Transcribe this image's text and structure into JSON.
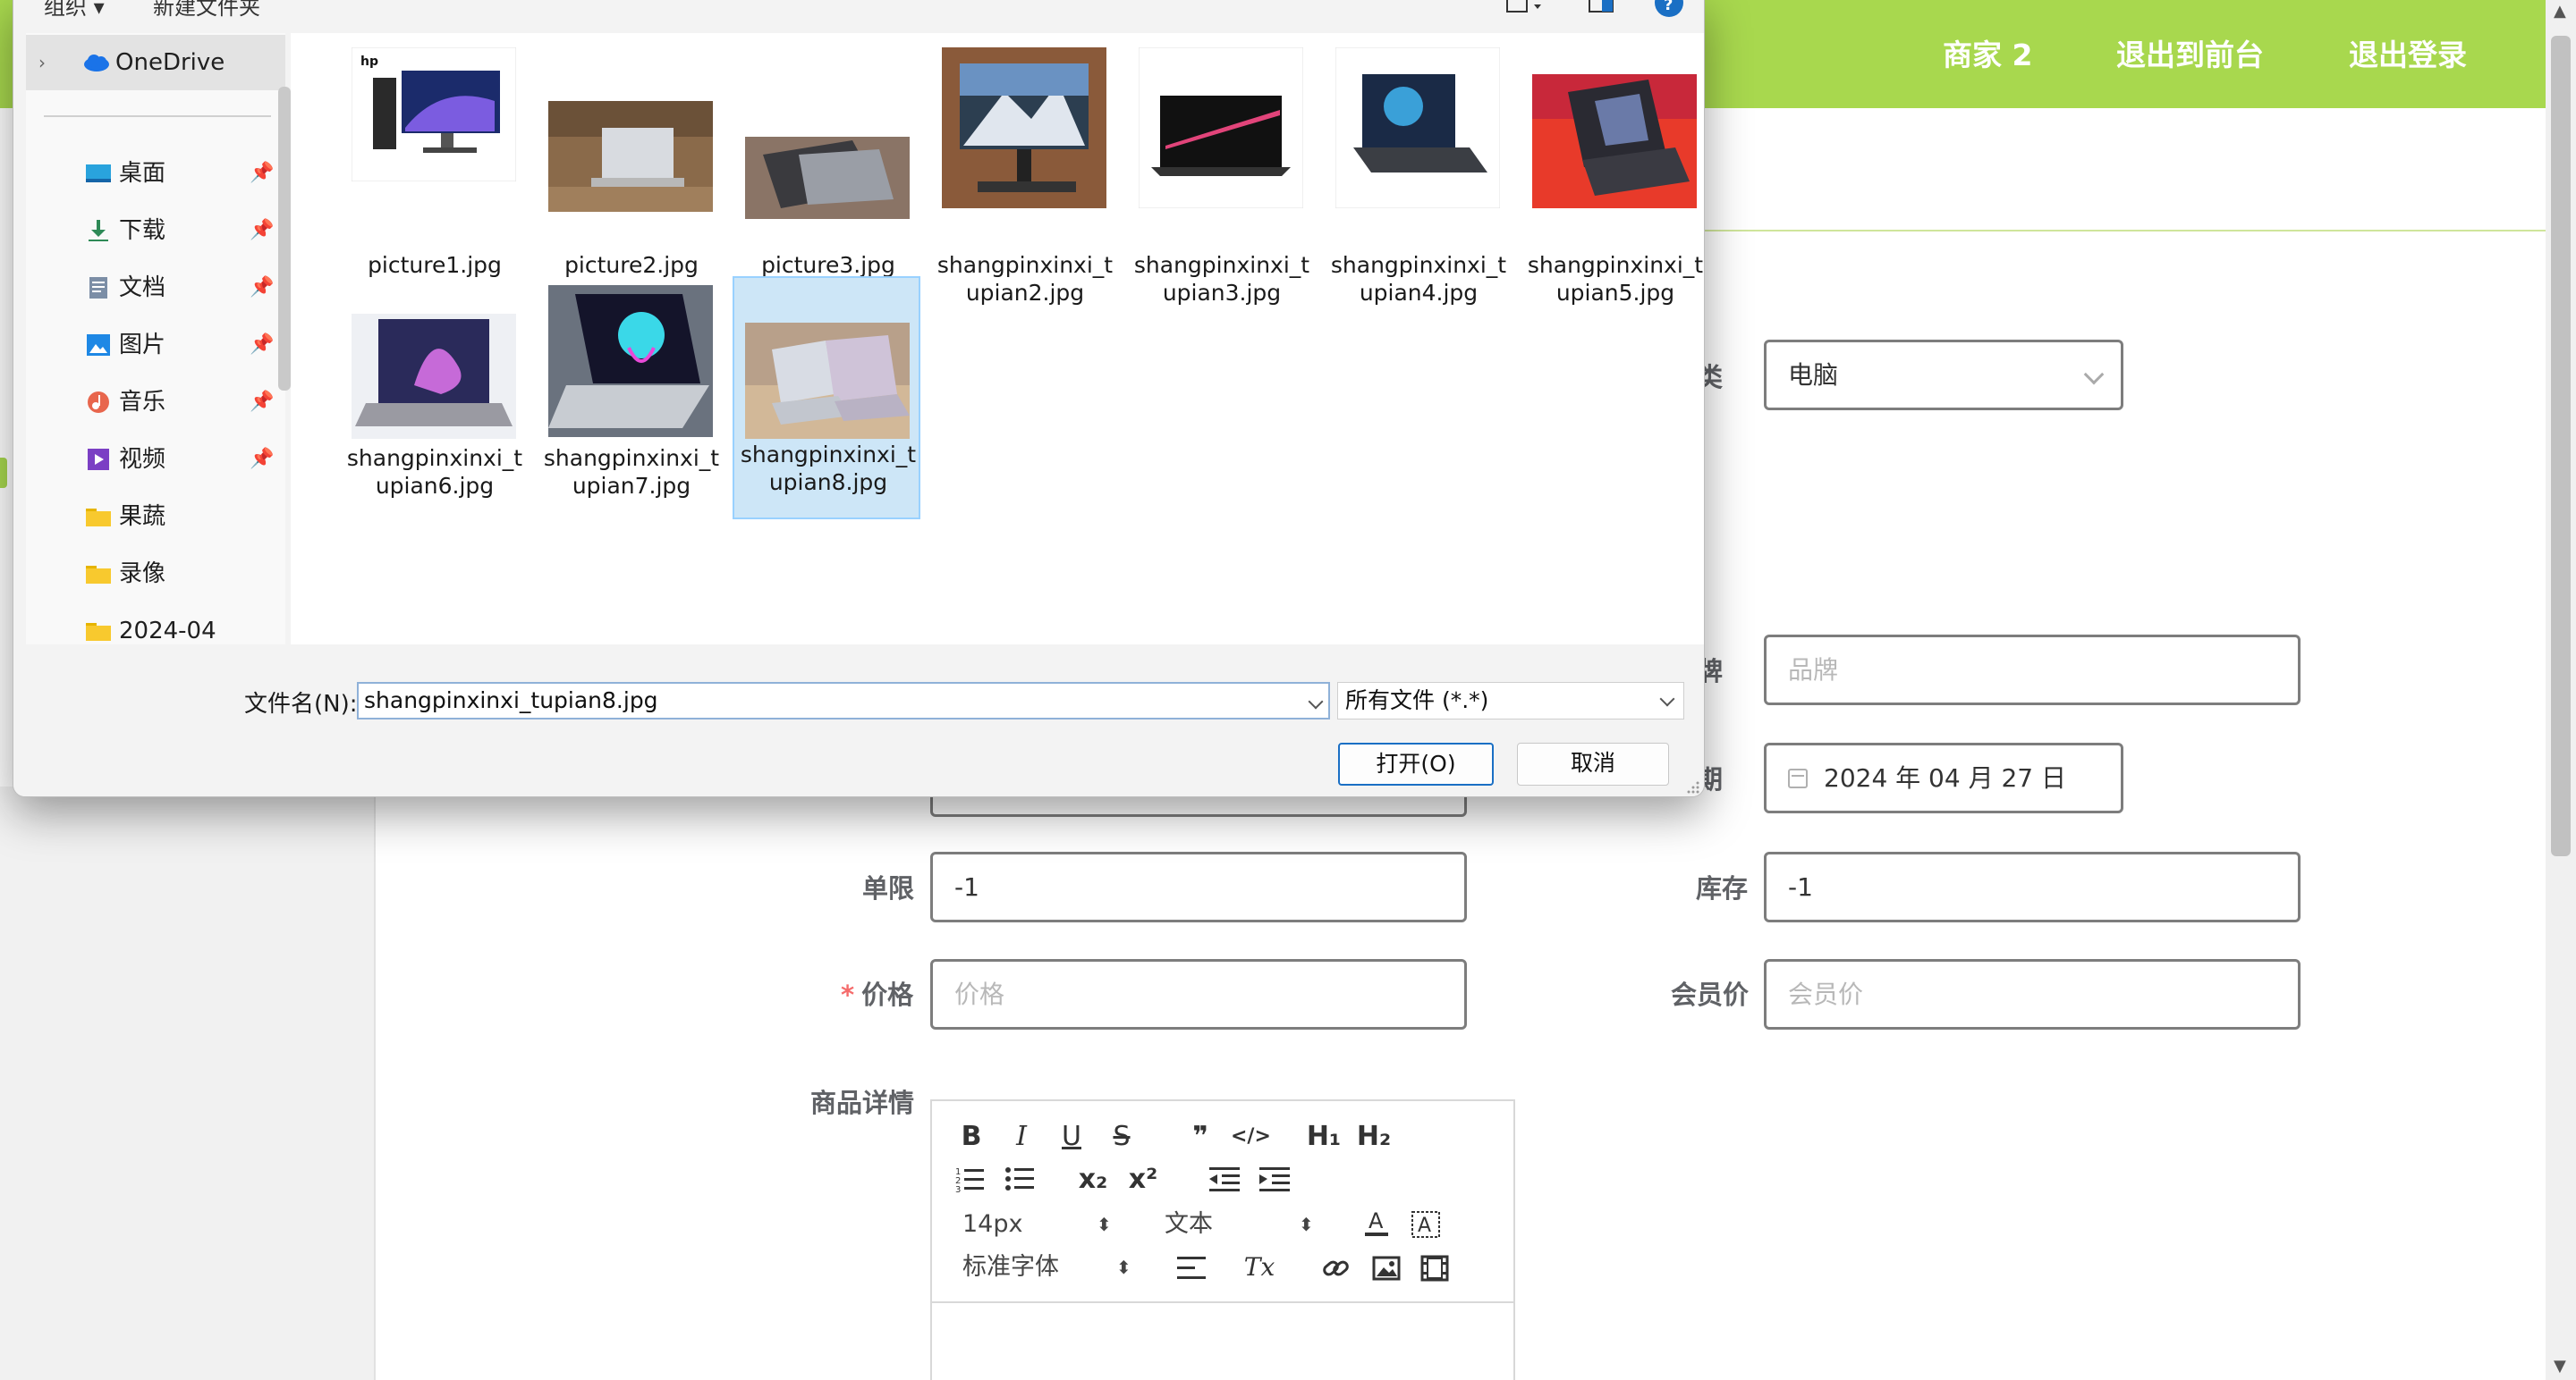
{
  "top_nav": {
    "links": [
      "商家 2",
      "退出到前台",
      "退出登录"
    ]
  },
  "form": {
    "category": {
      "label": "分类",
      "value": "电脑"
    },
    "brand": {
      "label": "品牌",
      "placeholder": "品牌"
    },
    "date": {
      "label": "日期",
      "value": "2024 年 04 月 27 日"
    },
    "limit": {
      "label": "单限",
      "value": "-1"
    },
    "stock": {
      "label": "库存",
      "value": "-1"
    },
    "price": {
      "label": "价格",
      "required_mark": "*",
      "placeholder": "价格"
    },
    "member_price": {
      "label": "会员价",
      "placeholder": "会员价"
    },
    "details": {
      "label": "商品详情"
    }
  },
  "editor": {
    "font_size": "14px",
    "text_style": "文本",
    "font_family": "标准字体",
    "bold": "B",
    "italic": "I",
    "underline": "U",
    "strike": "S",
    "blockquote": "❞",
    "code": "</>",
    "h1": "H₁",
    "h2": "H₂",
    "subscript": "x₂",
    "superscript": "x²",
    "clear_format": "Tx"
  },
  "dialog": {
    "toolbar": {
      "organize": "组织 ▾",
      "new_folder": "新建文件夹"
    },
    "nav": [
      {
        "label": "OneDrive",
        "icon": "cloud-icon"
      },
      {
        "label": "桌面",
        "icon": "desktop-icon",
        "pinned": true
      },
      {
        "label": "下载",
        "icon": "download-icon",
        "pinned": true
      },
      {
        "label": "文档",
        "icon": "document-icon",
        "pinned": true
      },
      {
        "label": "图片",
        "icon": "pictures-icon",
        "pinned": true
      },
      {
        "label": "音乐",
        "icon": "music-icon",
        "pinned": true
      },
      {
        "label": "视频",
        "icon": "video-icon",
        "pinned": true
      },
      {
        "label": "果蔬",
        "icon": "folder-icon"
      },
      {
        "label": "录像",
        "icon": "folder-icon"
      },
      {
        "label": "2024-04",
        "icon": "folder-icon"
      }
    ],
    "files": [
      {
        "name": "picture1.jpg"
      },
      {
        "name": "picture2.jpg"
      },
      {
        "name": "picture3.jpg"
      },
      {
        "name": "shangpinxinxi_t\nupian2.jpg"
      },
      {
        "name": "shangpinxinxi_t\nupian3.jpg"
      },
      {
        "name": "shangpinxinxi_t\nupian4.jpg"
      },
      {
        "name": "shangpinxinxi_t\nupian5.jpg"
      },
      {
        "name": "shangpinxinxi_t\nupian6.jpg"
      },
      {
        "name": "shangpinxinxi_t\nupian7.jpg"
      },
      {
        "name": "shangpinxinxi_t\nupian8.jpg",
        "selected": true
      }
    ],
    "filename_label": "文件名(N):",
    "filename_value": "shangpinxinxi_tupian8.jpg",
    "filter": "所有文件 (*.*)",
    "open_button": "打开(O)",
    "cancel_button": "取消"
  },
  "colors": {
    "brand_green": "#a8d84e",
    "selection_blue": "#cde6f7",
    "required_red": "#f56c6c"
  }
}
